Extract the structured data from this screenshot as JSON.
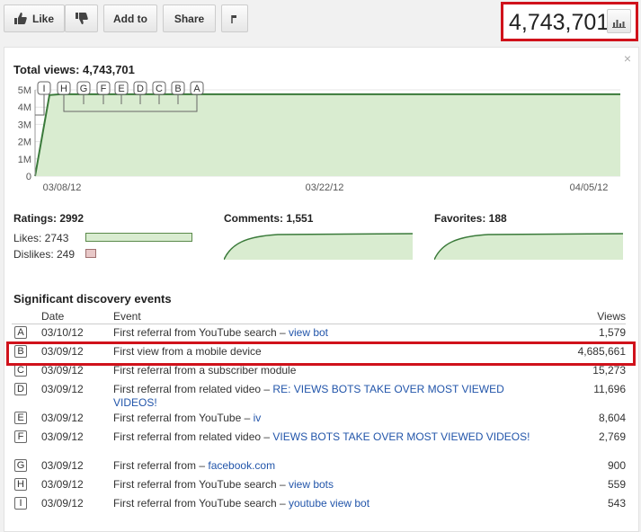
{
  "toolbar": {
    "like_label": "Like",
    "add_to_label": "Add to",
    "share_label": "Share",
    "view_count": "4,743,701"
  },
  "stats": {
    "total_views_label": "Total views: 4,743,701",
    "close_symbol": "×",
    "chart_data": {
      "type": "line",
      "x": [
        "03/06/12",
        "03/07/12",
        "03/08/12",
        "03/22/12",
        "04/05/12"
      ],
      "values": [
        0,
        4700000,
        4743701,
        4743701,
        4743701
      ],
      "x_tick_labels": [
        "03/08/12",
        "03/22/12",
        "04/05/12"
      ],
      "y_tick_labels": [
        "0",
        "1M",
        "2M",
        "3M",
        "4M",
        "5M"
      ],
      "ylim": [
        0,
        5000000
      ],
      "markers": [
        "I",
        "H",
        "G",
        "F",
        "E",
        "D",
        "C",
        "B",
        "A"
      ],
      "line_color": "#3a7a3a",
      "fill_color": "#d9ecd0"
    },
    "ratings_label": "Ratings: 2992",
    "likes_label": "Likes: 2743",
    "dislikes_label": "Dislikes: 249",
    "likes_fraction": 0.917,
    "comments_label": "Comments: 1,551",
    "favorites_label": "Favorites: 188"
  },
  "events": {
    "heading": "Significant discovery events",
    "columns": [
      "Date",
      "Event",
      "Views"
    ],
    "rows": [
      {
        "letter": "A",
        "date": "03/10/12",
        "text": "First referral from YouTube search – ",
        "link": "view bot",
        "views": "1,579"
      },
      {
        "letter": "B",
        "date": "03/09/12",
        "text": "First view from a mobile device",
        "link": "",
        "views": "4,685,661"
      },
      {
        "letter": "C",
        "date": "03/09/12",
        "text": "First referral from a subscriber module",
        "link": "",
        "views": "15,273"
      },
      {
        "letter": "D",
        "date": "03/09/12",
        "text": "First referral from related video – ",
        "link": "RE: VIEWS BOTS TAKE OVER MOST VIEWED VIDEOS!",
        "views": "11,696"
      },
      {
        "letter": "E",
        "date": "03/09/12",
        "text": "First referral from YouTube – ",
        "link": "iv",
        "views": "8,604"
      },
      {
        "letter": "F",
        "date": "03/09/12",
        "text": "First referral from related video – ",
        "link": "VIEWS BOTS TAKE OVER MOST VIEWED VIDEOS!",
        "views": "2,769"
      },
      {
        "letter": "G",
        "date": "03/09/12",
        "text": "First referral from – ",
        "link": "facebook.com",
        "views": "900"
      },
      {
        "letter": "H",
        "date": "03/09/12",
        "text": "First referral from YouTube search – ",
        "link": "view bots",
        "views": "559"
      },
      {
        "letter": "I",
        "date": "03/09/12",
        "text": "First referral from YouTube search – ",
        "link": "youtube view bot",
        "views": "543"
      }
    ]
  }
}
